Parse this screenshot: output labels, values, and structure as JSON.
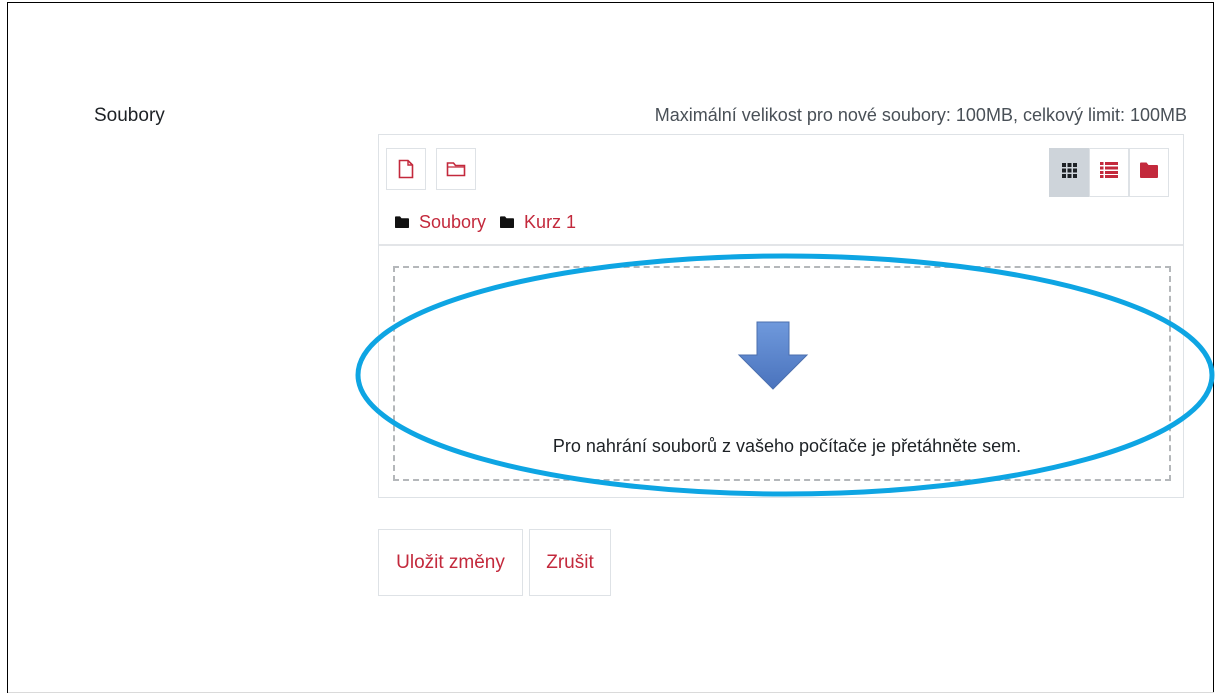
{
  "form": {
    "field_label": "Soubory",
    "limits_text": "Maximální velikost pro nové soubory: 100MB, celkový limit: 100MB"
  },
  "filemanager": {
    "toolbar": {
      "add_file_icon": "file-icon",
      "create_folder_icon": "folder-outline-icon"
    },
    "views": [
      {
        "icon": "grid-icon",
        "active": true
      },
      {
        "icon": "list-icon",
        "active": false
      },
      {
        "icon": "folder-tree-icon",
        "active": false
      }
    ],
    "path": [
      "Soubory",
      "Kurz 1"
    ],
    "dropzone_message": "Pro nahrání souborů z vašeho počítače je přetáhněte sem."
  },
  "buttons": {
    "save_label": "Uložit změny",
    "cancel_label": "Zrušit"
  },
  "colors": {
    "accent": "#c3293c",
    "highlight": "#0ea5e3",
    "arrow": "#5b86cf"
  }
}
